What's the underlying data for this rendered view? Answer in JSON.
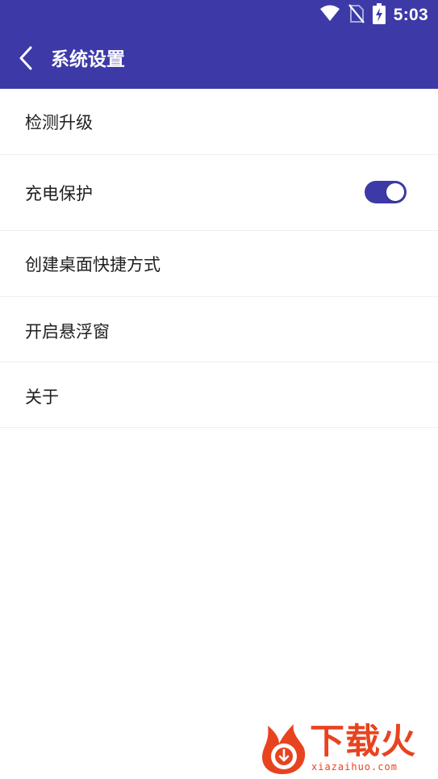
{
  "status_bar": {
    "time": "5:03",
    "icons": [
      "wifi-icon",
      "no-sim-icon",
      "battery-charging-icon"
    ]
  },
  "app_bar": {
    "back_icon": "chevron-left-icon",
    "title": "系统设置"
  },
  "settings": {
    "items": [
      {
        "label": "检测升级"
      },
      {
        "label": "充电保护",
        "toggle_on": true
      },
      {
        "label": "创建桌面快捷方式"
      },
      {
        "label": "开启悬浮窗"
      },
      {
        "label": "关于"
      }
    ]
  },
  "watermark": {
    "brand": "下载火",
    "domain": "xiazaihuo.com",
    "logo_icon": "flame-download-logo-icon"
  },
  "colors": {
    "primary": "#3d3aa8",
    "toggle_on": "#3d3aa8",
    "watermark": "#e8431f"
  }
}
